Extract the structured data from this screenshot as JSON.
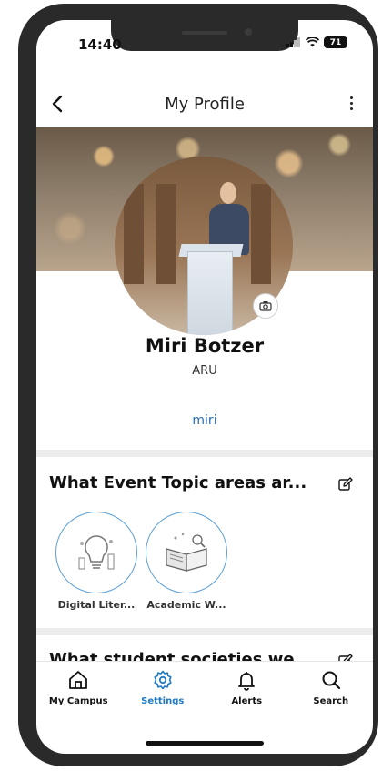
{
  "status_bar": {
    "time": "14:40",
    "battery": "71"
  },
  "header": {
    "title": "My Profile",
    "back_icon": "chevron-left-icon",
    "menu_icon": "more-vertical-icon"
  },
  "profile": {
    "name": "Miri Botzer",
    "organization": "ARU",
    "handle": "miri"
  },
  "topics_section": {
    "title": "What Event Topic areas ar...",
    "items": [
      {
        "label": "Digital Liter..."
      },
      {
        "label": "Academic W..."
      }
    ]
  },
  "societies_section": {
    "title": "What student societies we..."
  },
  "bottom_nav": {
    "items": [
      {
        "label": "My Campus",
        "icon": "home-icon"
      },
      {
        "label": "Settings",
        "icon": "gear-icon",
        "active": true
      },
      {
        "label": "Alerts",
        "icon": "bell-icon"
      },
      {
        "label": "Search",
        "icon": "search-icon"
      }
    ]
  },
  "colors": {
    "accent": "#1f79c3",
    "link": "#2a6fb0",
    "topic_ring": "#5b9fd6"
  }
}
